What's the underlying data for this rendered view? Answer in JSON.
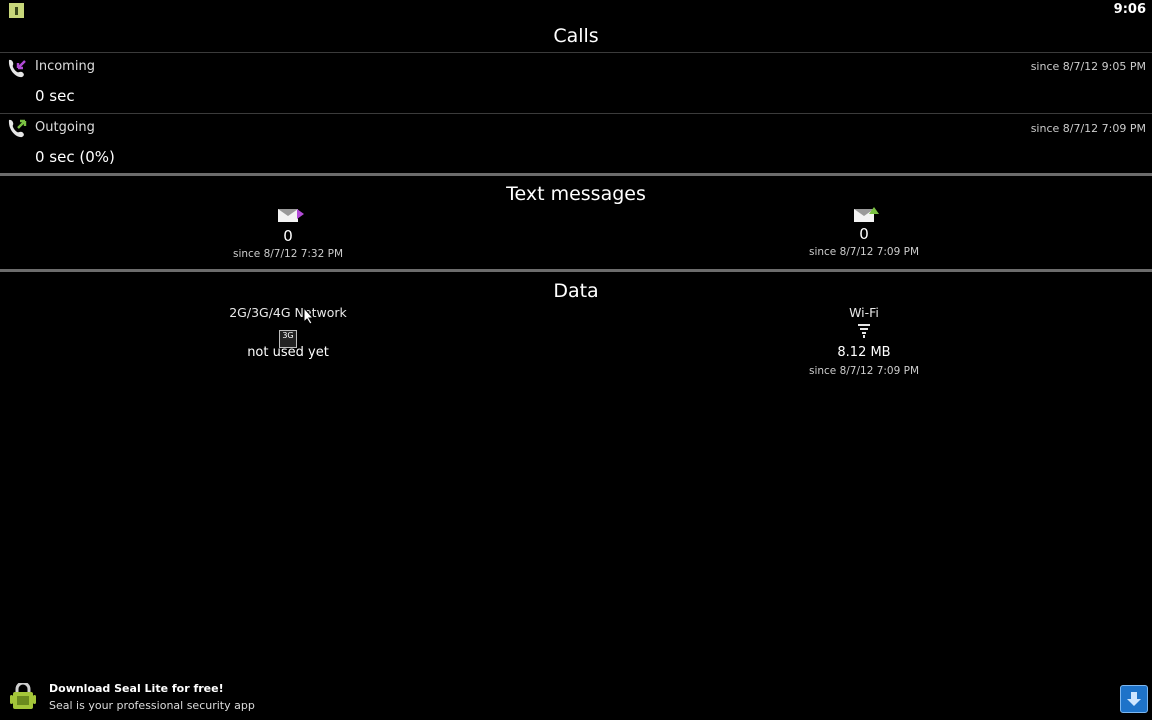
{
  "statusbar": {
    "time": "9:06"
  },
  "calls": {
    "title": "Calls",
    "incoming": {
      "label": "Incoming",
      "value": "0 sec",
      "since": "since 8/7/12 9:05 PM"
    },
    "outgoing": {
      "label": "Outgoing",
      "value": "0 sec (0%)",
      "since": "since 8/7/12 7:09 PM"
    }
  },
  "sms": {
    "title": "Text messages",
    "received": {
      "count": "0",
      "since": "since 8/7/12 7:32 PM"
    },
    "sent": {
      "count": "0",
      "since": "since 8/7/12 7:09 PM"
    }
  },
  "data": {
    "title": "Data",
    "mobile": {
      "label": "2G/3G/4G Network",
      "icon_text": "3G",
      "value": "not used yet"
    },
    "wifi": {
      "label": "Wi-Fi",
      "value": "8.12 MB",
      "since": "since 8/7/12 7:09 PM"
    }
  },
  "ad": {
    "title": "Download Seal Lite for free!",
    "subtitle": "Seal is your professional security app"
  },
  "colors": {
    "incoming_arrow": "#b24bd7",
    "outgoing_arrow": "#7ac142",
    "download_button": "#1e73c9"
  },
  "icons": {
    "status_app": "app-notification-icon",
    "incoming": "incoming-call-icon",
    "outgoing": "outgoing-call-icon",
    "sms_received": "sms-received-icon",
    "sms_sent": "sms-sent-icon",
    "mobile_data": "mobile-network-icon",
    "wifi": "wifi-icon",
    "ad": "android-lock-icon",
    "download": "download-arrow-icon"
  }
}
